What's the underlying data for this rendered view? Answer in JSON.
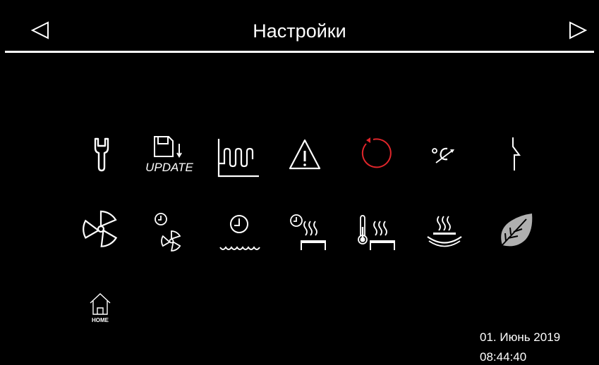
{
  "header": {
    "title": "Настройки",
    "prev_icon": "triangle-left-icon",
    "next_icon": "triangle-right-icon"
  },
  "grid": {
    "row1": [
      {
        "name": "wrench-icon"
      },
      {
        "name": "update-icon",
        "label": "UPDATE"
      },
      {
        "name": "heating-element-icon"
      },
      {
        "name": "warning-icon"
      },
      {
        "name": "reset-icon",
        "color": "#e0262b"
      },
      {
        "name": "temperature-calibration-icon"
      },
      {
        "name": "relay-switch-icon"
      }
    ],
    "row2": [
      {
        "name": "fan-icon"
      },
      {
        "name": "fan-timer-icon"
      },
      {
        "name": "water-timer-icon"
      },
      {
        "name": "heating-timer-icon"
      },
      {
        "name": "thermometer-heating-icon"
      },
      {
        "name": "steam-bowl-icon"
      },
      {
        "name": "eco-leaf-icon",
        "color": "#b0b0b0"
      }
    ]
  },
  "home": {
    "icon": "home-icon",
    "label": "HOME"
  },
  "status": {
    "date": "01. Июнь 2019",
    "time": "08:44:40"
  }
}
